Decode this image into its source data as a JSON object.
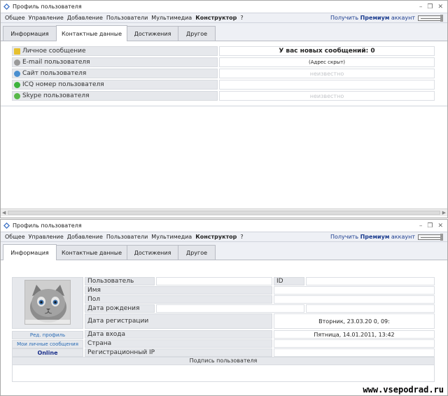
{
  "window1": {
    "title": "Профиль пользователя",
    "menu": [
      "Общее",
      "Управление",
      "Добавление",
      "Пользователи",
      "Мультимедиа"
    ],
    "menu_bold": "Конструктор",
    "menu_help": "?",
    "premium_prefix": "Получить",
    "premium_bold": "Премиум",
    "premium_suffix": "аккаунт",
    "tabs": [
      "Информация",
      "Контактные данные",
      "Достижения",
      "Другое"
    ],
    "active_tab": 1,
    "rows": [
      {
        "label": "Личное сообщение",
        "value": "У вас новых сообщений: 0",
        "icon": "envelope-icon",
        "color": "#e6c030"
      },
      {
        "label": "E-mail пользователя",
        "value": "(Адрес скрыт)",
        "icon": "email-icon",
        "color": "#9a9a9a"
      },
      {
        "label": "Сайт пользователя",
        "value": "неизвестно",
        "icon": "globe-icon",
        "color": "#4a8fd0"
      },
      {
        "label": "ICQ номер пользователя",
        "value": "",
        "icon": "icq-flower-icon",
        "color": "#3db33d"
      },
      {
        "label": "Skype пользователя",
        "value": "неизвестно",
        "icon": "skype-icon",
        "color": "#58b84a"
      }
    ]
  },
  "window2": {
    "title": "Профиль пользователя",
    "menu": [
      "Общее",
      "Управление",
      "Добавление",
      "Пользователи",
      "Мультимедиа"
    ],
    "menu_bold": "Конструктор",
    "menu_help": "?",
    "premium_prefix": "Получить",
    "premium_bold": "Премиум",
    "premium_suffix": "аккаунт",
    "tabs": [
      "Информация",
      "Контактные данные",
      "Достижения",
      "Другое"
    ],
    "active_tab": 0,
    "edit_profile": "Ред. профиль",
    "my_messages": "Мои личные сообщения",
    "status": "Online",
    "fields": {
      "user": "Пользователь",
      "id": "ID",
      "name": "Имя",
      "gender": "Пол",
      "birthday": "Дата рождения",
      "reg_date": "Дата регистрации",
      "reg_date_value": "Вторник, 23.03.20  0, 09:",
      "login_date": "Дата входа",
      "login_date_value": "Пятница, 14.01.2011, 13:42",
      "country": "Страна",
      "reg_ip": "Регистрационный IP"
    },
    "signature": "Подпись пользователя"
  },
  "watermark": "www.vsepodrad.ru"
}
